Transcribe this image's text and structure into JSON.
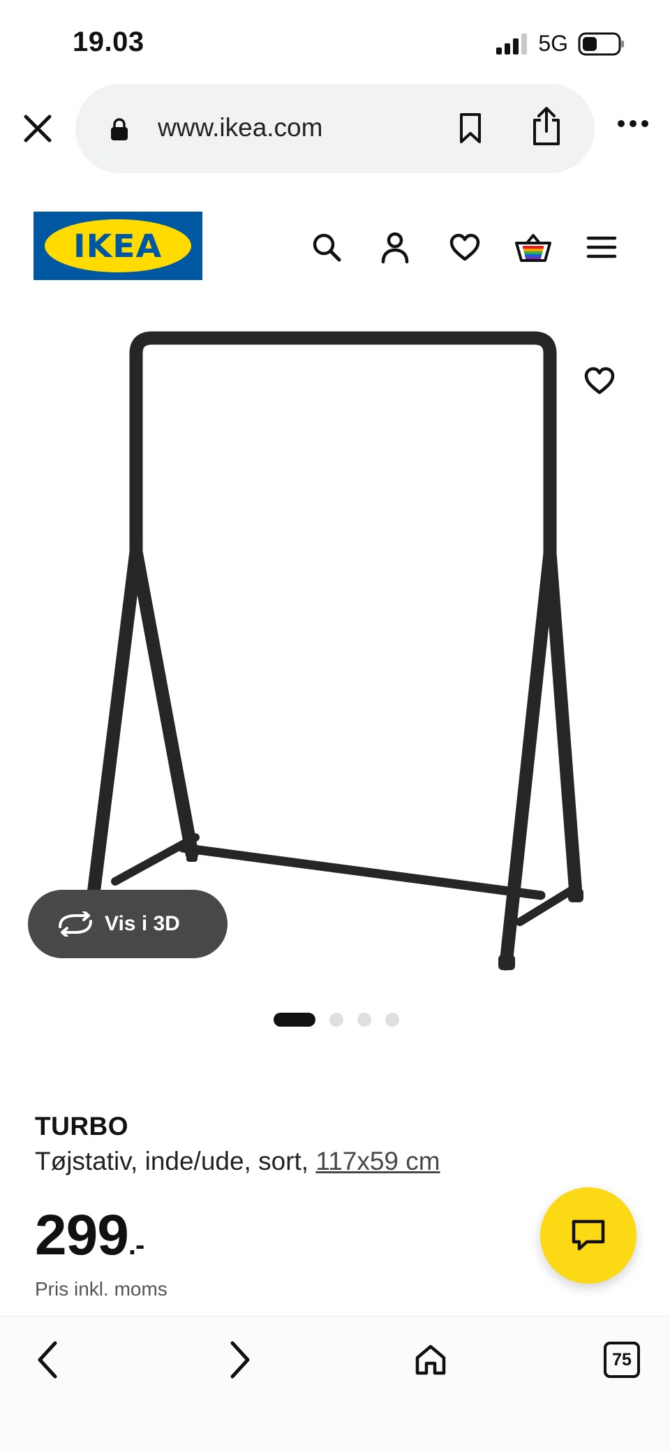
{
  "status_bar": {
    "time": "19.03",
    "network": "5G"
  },
  "browser": {
    "url": "www.ikea.com",
    "open_tabs": "75"
  },
  "header": {
    "logo_text": "IKEA",
    "icons": [
      "search-icon",
      "account-icon",
      "wishlist-icon",
      "basket-icon",
      "menu-icon"
    ]
  },
  "gallery": {
    "view_3d_label": "Vis i 3D",
    "image_count": 4,
    "active_image": 1
  },
  "product": {
    "name": "TURBO",
    "description": "Tøjstativ, inde/ude, sort, ",
    "size": "117x59 cm",
    "price": "299",
    "price_suffix": ".-",
    "vat_note": "Pris inkl. moms"
  },
  "colors": {
    "ikea_blue": "#0058a3",
    "ikea_yellow": "#ffdb00",
    "chat_yellow": "#fbd914",
    "pill_gray": "#f0f2f4",
    "button_dark": "#484848"
  }
}
